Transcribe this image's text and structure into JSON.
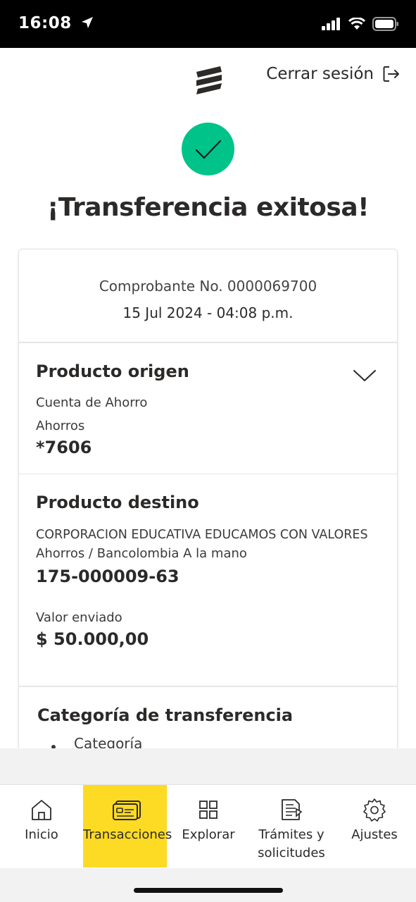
{
  "status_bar": {
    "time": "16:08"
  },
  "header": {
    "logout_label": "Cerrar sesión"
  },
  "success": {
    "title": "¡Transferencia exitosa!"
  },
  "receipt": {
    "number_label": "Comprobante No. 0000069700",
    "datetime": "15 Jul 2024 - 04:08 p.m."
  },
  "origin": {
    "title": "Producto origen",
    "account_type": "Cuenta de Ahorro",
    "account_subtype": "Ahorros",
    "account_number": "*7606"
  },
  "destination": {
    "title": "Producto destino",
    "name": "CORPORACION EDUCATIVA EDUCAMOS CON VALORES",
    "subtype": "Ahorros / Bancolombia A la mano",
    "account_number": "175-000009-63",
    "amount_label": "Valor enviado",
    "amount": "$ 50.000,00"
  },
  "category": {
    "title": "Categoría de transferencia",
    "item": "Categoría"
  },
  "nav": {
    "items": [
      {
        "label": "Inicio",
        "icon": "home-icon"
      },
      {
        "label": "Transacciones",
        "icon": "card-icon",
        "active": true
      },
      {
        "label": "Explorar",
        "icon": "grid-icon"
      },
      {
        "label": "Trámites y solicitudes",
        "icon": "document-icon"
      },
      {
        "label": "Ajustes",
        "icon": "gear-icon"
      }
    ]
  },
  "colors": {
    "accent": "#fdda24",
    "success": "#00c389",
    "text": "#2c2a29"
  }
}
